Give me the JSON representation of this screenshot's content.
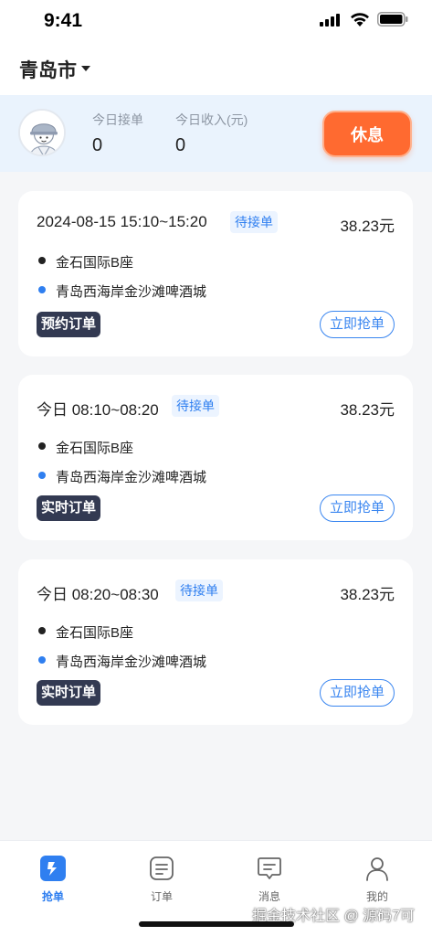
{
  "status_bar": {
    "time": "9:41"
  },
  "header": {
    "city": "青岛市"
  },
  "rider": {
    "stats": [
      {
        "label": "今日接单",
        "value": "0"
      },
      {
        "label": "今日收入(元)",
        "value": "0"
      }
    ],
    "rest_button": "休息"
  },
  "orders": [
    {
      "time": "2024-08-15 15:10~15:20",
      "status": "待接单",
      "price": "38.23元",
      "pickup": "金石国际B座",
      "dropoff": "青岛西海岸金沙滩啤酒城",
      "type": "预约订单",
      "action": "立即抢单"
    },
    {
      "time": "今日 08:10~08:20",
      "status": "待接单",
      "price": "38.23元",
      "pickup": "金石国际B座",
      "dropoff": "青岛西海岸金沙滩啤酒城",
      "type": "实时订单",
      "action": "立即抢单"
    },
    {
      "time": "今日 08:20~08:30",
      "status": "待接单",
      "price": "38.23元",
      "pickup": "金石国际B座",
      "dropoff": "青岛西海岸金沙滩啤酒城",
      "type": "实时订单",
      "action": "立即抢单"
    }
  ],
  "tabs": [
    {
      "label": "抢单",
      "icon": "grab-order-icon",
      "active": true
    },
    {
      "label": "订单",
      "icon": "order-list-icon",
      "active": false
    },
    {
      "label": "消息",
      "icon": "message-icon",
      "active": false
    },
    {
      "label": "我的",
      "icon": "profile-icon",
      "active": false
    }
  ],
  "watermark": "掘金技术社区 @ 源码7可",
  "colors": {
    "accent": "#2f7ff0",
    "rest_button": "#ff6a30",
    "order_type_badge": "#333a52",
    "pickup_dot": "#222222",
    "dropoff_dot": "#2f7ff0"
  }
}
